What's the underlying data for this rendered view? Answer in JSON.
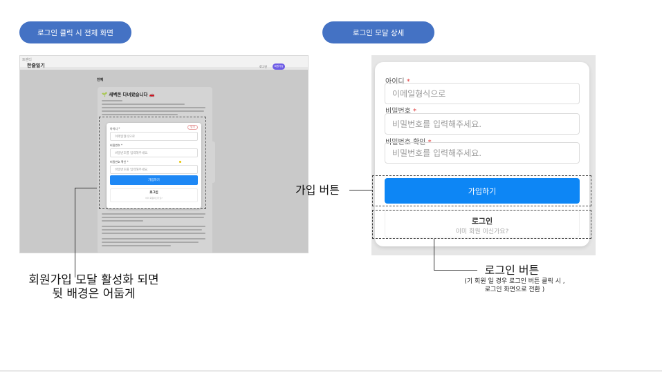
{
  "labels": {
    "left_section": "로그인 클릭 시 전체 화면",
    "right_section": "로그인 모달 상세"
  },
  "left_screenshot": {
    "brand_small": "트렌디",
    "brand": "한줄일기",
    "nav_link": "로그인",
    "nav_button": "회원가입",
    "section_title": "전체",
    "post_title": "🌱 새벽돈 다녀왔습니다 🚗",
    "modal": {
      "close": "닫기",
      "id_label": "아이디 *",
      "id_placeholder": "이메일형식으로",
      "pw_label": "비밀번호 *",
      "pw_placeholder": "비밀번호를 입력해주세요.",
      "pw_confirm_label": "비밀번호 확인 *",
      "pw_confirm_placeholder": "비밀번호를 입력해주세요.",
      "join_button": "가입하기",
      "login_title": "로그인",
      "login_sub": "이미 회원이신가요?"
    }
  },
  "left_caption": {
    "line1": "회원가입 모달 활성화 되면",
    "line2": "뒷 배경은 어둡게"
  },
  "modal_detail": {
    "id_label": "아이디",
    "id_placeholder": "이메일형식으로",
    "pw_label": "비밀번호",
    "pw_placeholder": "비밀번호를 입력해주세요.",
    "pw_confirm_label": "비밀번호 확인",
    "pw_confirm_placeholder": "비밀번호를 입력해주세요.",
    "required_mark": "*",
    "join_button": "가입하기",
    "login_title": "로그인",
    "login_sub": "이미 회원 이신가요?"
  },
  "callouts": {
    "join": "가입 버튼",
    "login": "로그인 버튼",
    "login_note_line1": "(기 회원 일 경우 로그인 버튼 클릭 시 ,",
    "login_note_line2": "로그인 화면으로 전환 )"
  },
  "colors": {
    "pill": "#4472c4",
    "join_button": "#0d86f5",
    "nav_button": "#6e5ce6",
    "required": "#e03e3e"
  }
}
